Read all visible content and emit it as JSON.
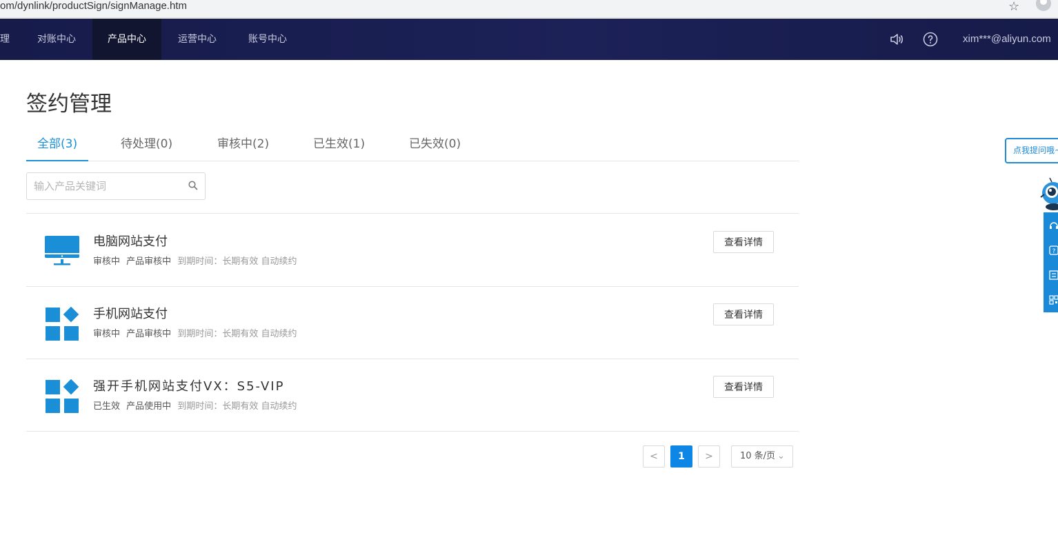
{
  "browser": {
    "url": "om/dynlink/productSign/signManage.htm"
  },
  "topnav": {
    "partial_item": "理",
    "items": [
      "对账中心",
      "产品中心",
      "运营中心",
      "账号中心"
    ],
    "active_index": 1,
    "user": "xim***@aliyun.com"
  },
  "page": {
    "title": "签约管理"
  },
  "tabs": [
    {
      "label": "全部(3)"
    },
    {
      "label": "待处理(0)"
    },
    {
      "label": "审核中(2)"
    },
    {
      "label": "已生效(1)"
    },
    {
      "label": "已失效(0)"
    }
  ],
  "search": {
    "placeholder": "输入产品关键词",
    "value": ""
  },
  "products": [
    {
      "name": "电脑网站支付",
      "icon": "monitor-icon",
      "status": "审核中",
      "product_status": "产品审核中",
      "expiry": "到期时间：长期有效 自动续约",
      "button": "查看详情"
    },
    {
      "name": "手机网站支付",
      "icon": "app-grid-icon",
      "status": "审核中",
      "product_status": "产品审核中",
      "expiry": "到期时间：长期有效 自动续约",
      "button": "查看详情"
    },
    {
      "name": "强开手机网站支付VX：S5-VIP",
      "icon": "app-grid-icon",
      "status": "已生效",
      "product_status": "产品使用中",
      "expiry": "到期时间：长期有效 自动续约",
      "button": "查看详情"
    }
  ],
  "pagination": {
    "prev": "<",
    "current": "1",
    "next": ">",
    "page_size": "10 条/页"
  },
  "side_widget": {
    "ask_label": "点我提问哦~"
  },
  "colors": {
    "nav_bg": "#1c2157",
    "accent": "#1a8fd8",
    "icon_blue": "#1a8fd8",
    "page_active": "#0d86e6"
  }
}
